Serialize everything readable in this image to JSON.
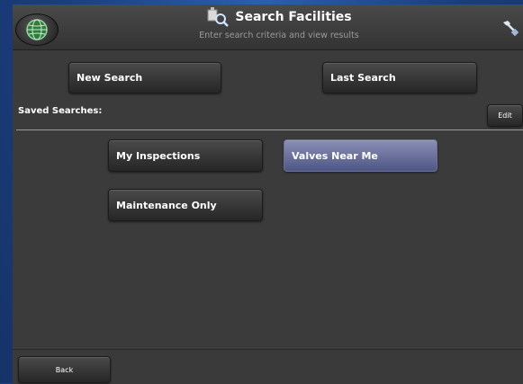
{
  "header": {
    "title": "Search Facilities",
    "subtitle": "Enter search criteria and view results"
  },
  "actions": {
    "new_search": "New Search",
    "last_search": "Last Search"
  },
  "saved": {
    "label": "Saved Searches:",
    "edit": "Edit",
    "items": [
      {
        "label": "My Inspections",
        "selected": false
      },
      {
        "label": "Valves Near Me",
        "selected": true
      },
      {
        "label": "Maintenance Only",
        "selected": false
      }
    ]
  },
  "footer": {
    "back": "Back"
  },
  "icons": {
    "globe": "globe-icon",
    "search": "search-facilities-icon",
    "tools": "tools-icon"
  },
  "colors": {
    "background": "#1b3f7e",
    "panel": "#3b3b3b",
    "selected": "#6e74a0"
  }
}
